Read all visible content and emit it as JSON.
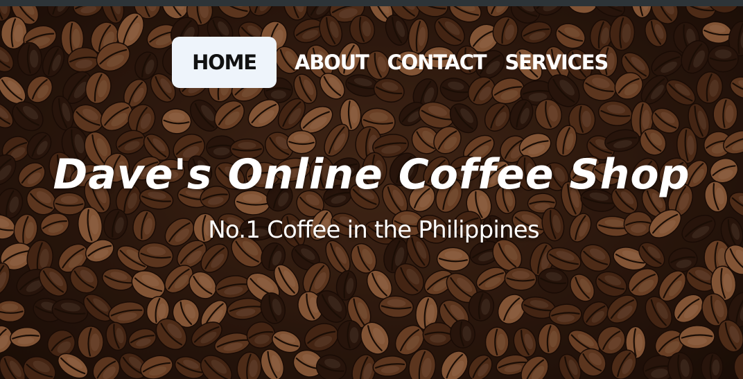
{
  "nav": {
    "items": [
      {
        "label": "HOME",
        "active": true
      },
      {
        "label": "ABOUT",
        "active": false
      },
      {
        "label": "CONTACT",
        "active": false
      },
      {
        "label": "SERVICES",
        "active": false
      }
    ]
  },
  "hero": {
    "title": "Dave's Online Coffee Shop",
    "subtitle": "No.1 Coffee in the Philippines",
    "background": "coffee-beans-photo"
  },
  "colors": {
    "active_nav_bg": "#eef4fb",
    "active_nav_text": "#111111",
    "nav_text": "#ffffff",
    "hero_text": "#ffffff",
    "bean_dark": "#2b170d",
    "bean_mid": "#6b3f24",
    "bean_light": "#9a6440",
    "top_strip": "#2d3438"
  }
}
